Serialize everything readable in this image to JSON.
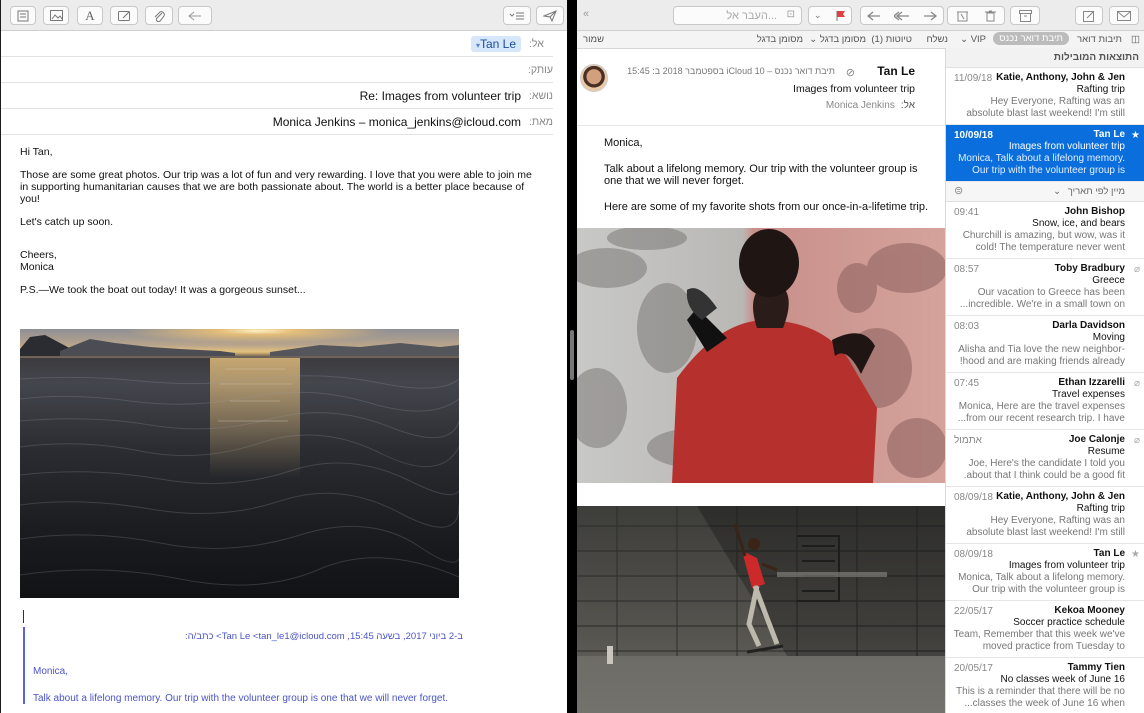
{
  "compose": {
    "to_label": "אל:",
    "to_value": "Tan Le",
    "cc_label": "עותק:",
    "subject_label": "נושא:",
    "subject_value": "Re: Images from volunteer trip",
    "from_label": "מאת:",
    "from_value": "Monica Jenkins – monica_jenkins@icloud.com",
    "body": {
      "greeting": "Hi Tan,",
      "paragraph": "Those are some great photos. Our trip was a lot of fun and very rewarding. I love that you were able to join me in supporting humanitarian causes that we are both passionate about. The world is a better place because of you!",
      "catch_up": "Let's catch up soon.",
      "closing_1": "Cheers,",
      "closing_2": "Monica",
      "ps": "P.S.—We took the boat out today! It was a gorgeous sunset..."
    },
    "quote": {
      "header": "ב-2 ביוני 2017, בשעה 15:45, Tan Le <tan_le1@icloud.com> כתב/ה:",
      "line1": "Monica,",
      "line2": "Talk about a lifelong memory. Our trip with the volunteer group is one that we will never forget."
    }
  },
  "viewer": {
    "search_placeholder": "העבר אל...",
    "favorites": {
      "mailboxes": "תיבות דואר",
      "inbox": "תיבת דואר נכנס",
      "vip": "VIP",
      "sent": "נשלח",
      "drafts": "טיוטות (1)",
      "flagged_a": "מסומן בדגל",
      "flagged_b": "מסומן בדגל",
      "save": "שמור"
    },
    "message": {
      "sender": "Tan Le",
      "meta": "תיבת דואר נכנס – iCloud 10 בספטמבר 2018 ב: 15:45",
      "subject": "Images from volunteer trip",
      "to_label": "אל:",
      "to_value": "Monica Jenkins",
      "body_greeting": "Monica,",
      "body_p1": "Talk about a lifelong memory. Our trip with the volunteer group is one that we will never forget.",
      "body_p2": "Here are some of my favorite shots from our once-in-a-lifetime trip."
    },
    "list": {
      "top_header": "התוצאות המובילות",
      "sort_label": "מיין לפי תאריך",
      "items": [
        {
          "name": "Katie, Anthony, John & Jen",
          "date": "11/09/18",
          "subject": "Rafting trip",
          "preview": "Hey Everyone, Rafting was an absolute blast last weekend! I'm still sore from...",
          "selected": false,
          "icon": ""
        },
        {
          "name": "Tan Le",
          "date": "10/09/18",
          "subject": "Images from volunteer trip",
          "preview": "Monica, Talk about a lifelong memory. Our trip with the volunteer group is one...",
          "selected": true,
          "icon": "★"
        },
        {
          "name": "John Bishop",
          "date": "09:41",
          "subject": "Snow, ice, and bears",
          "preview": "Churchill is amazing, but wow, was it cold! The temperature never went high...",
          "selected": false,
          "icon": ""
        },
        {
          "name": "Toby Bradbury",
          "date": "08:57",
          "subject": "Greece",
          "preview": "Our vacation to Greece has been incredible. We're in a small town on...",
          "selected": false,
          "icon": "⌀"
        },
        {
          "name": "Darla Davidson",
          "date": "08:03",
          "subject": "Moving",
          "preview": "Alisha and Tia love the new neighbor­hood and are making friends already!",
          "selected": false,
          "icon": ""
        },
        {
          "name": "Ethan Izzarelli",
          "date": "07:45",
          "subject": "Travel expenses",
          "preview": "Monica, Here are the travel expenses from our recent research trip. I have...",
          "selected": false,
          "icon": "⌀"
        },
        {
          "name": "Joe Calonje",
          "date": "אתמול",
          "subject": "Resume",
          "preview": "Joe, Here's the candidate I told you about that I think could be a good fit.",
          "selected": false,
          "icon": "⌀"
        },
        {
          "name": "Katie, Anthony, John & Jen",
          "date": "08/09/18",
          "subject": "Rafting trip",
          "preview": "Hey Everyone, Rafting was an absolute blast last weekend! I'm still sore from...",
          "selected": false,
          "icon": ""
        },
        {
          "name": "Tan Le",
          "date": "08/09/18",
          "subject": "Images from volunteer trip",
          "preview": "Monica, Talk about a lifelong memory. Our trip with the volunteer group is one...",
          "selected": false,
          "icon": "★"
        },
        {
          "name": "Kekoa Mooney",
          "date": "22/05/17",
          "subject": "Soccer practice schedule",
          "preview": "Team, Remember that this week we've moved practice from Tuesday to Thursday...",
          "selected": false,
          "icon": ""
        },
        {
          "name": "Tammy Tien",
          "date": "20/05/17",
          "subject": "No classes week of June 16",
          "preview": "This is a reminder that there will be no classes the week of June 16 when...",
          "selected": false,
          "icon": ""
        }
      ]
    }
  },
  "colors": {
    "accent": "#0a6fdc",
    "quote": "#4a54c8"
  }
}
